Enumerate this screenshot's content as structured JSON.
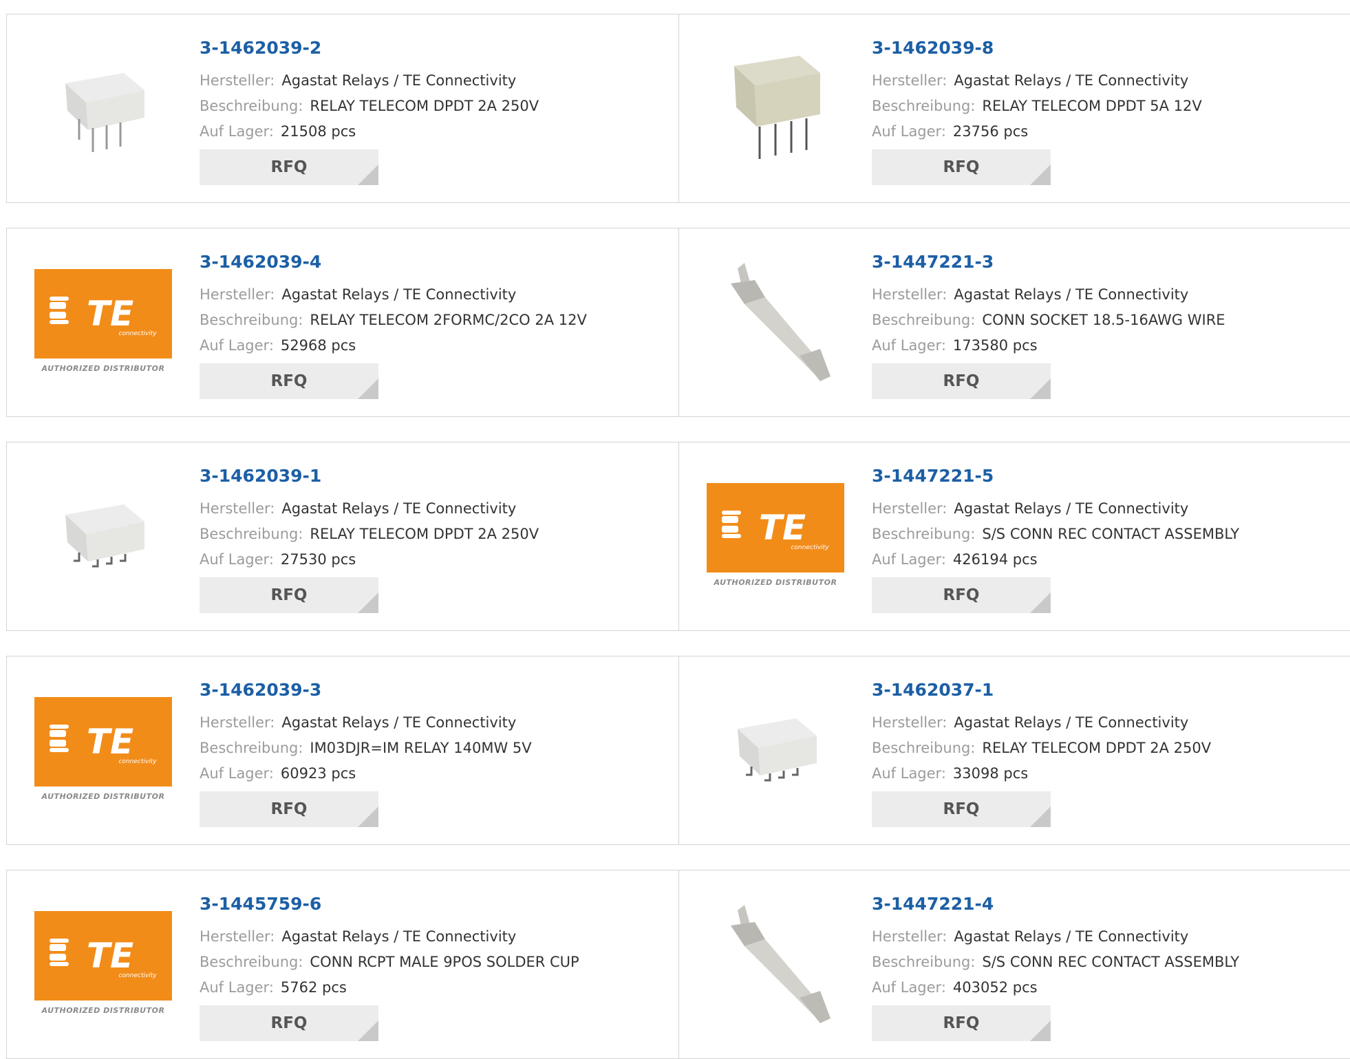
{
  "labels": {
    "manufacturer": "Hersteller:",
    "description": "Beschreibung:",
    "stock": "Auf Lager:",
    "rfq": "RFQ"
  },
  "te_logo": {
    "brand": "TE",
    "tagline": "connectivity",
    "badge": "AUTHORIZED DISTRIBUTOR"
  },
  "products": [
    {
      "pn": "3-1462039-2",
      "manufacturer": "Agastat Relays / TE Connectivity",
      "description": "RELAY TELECOM DPDT 2A 250V",
      "stock": "21508 pcs",
      "image": "relay-thru-hole"
    },
    {
      "pn": "3-1462039-8",
      "manufacturer": "Agastat Relays / TE Connectivity",
      "description": "RELAY TELECOM DPDT 5A 12V",
      "stock": "23756 pcs",
      "image": "relay-tan"
    },
    {
      "pn": "3-1462039-4",
      "manufacturer": "Agastat Relays / TE Connectivity",
      "description": "RELAY TELECOM 2FORMC/2CO 2A 12V",
      "stock": "52968 pcs",
      "image": "te-logo"
    },
    {
      "pn": "3-1447221-3",
      "manufacturer": "Agastat Relays / TE Connectivity",
      "description": "CONN SOCKET 18.5-16AWG WIRE",
      "stock": "173580 pcs",
      "image": "crimp-contact"
    },
    {
      "pn": "3-1462039-1",
      "manufacturer": "Agastat Relays / TE Connectivity",
      "description": "RELAY TELECOM DPDT 2A 250V",
      "stock": "27530 pcs",
      "image": "relay-smd"
    },
    {
      "pn": "3-1447221-5",
      "manufacturer": "Agastat Relays / TE Connectivity",
      "description": "S/S CONN REC CONTACT ASSEMBLY",
      "stock": "426194 pcs",
      "image": "te-logo"
    },
    {
      "pn": "3-1462039-3",
      "manufacturer": "Agastat Relays / TE Connectivity",
      "description": "IM03DJR=IM RELAY 140MW 5V",
      "stock": "60923 pcs",
      "image": "te-logo"
    },
    {
      "pn": "3-1462037-1",
      "manufacturer": "Agastat Relays / TE Connectivity",
      "description": "RELAY TELECOM DPDT 2A 250V",
      "stock": "33098 pcs",
      "image": "relay-smd"
    },
    {
      "pn": "3-1445759-6",
      "manufacturer": "Agastat Relays / TE Connectivity",
      "description": "CONN RCPT MALE 9POS SOLDER CUP",
      "stock": "5762 pcs",
      "image": "te-logo"
    },
    {
      "pn": "3-1447221-4",
      "manufacturer": "Agastat Relays / TE Connectivity",
      "description": "S/S CONN REC CONTACT ASSEMBLY",
      "stock": "403052 pcs",
      "image": "crimp-contact"
    }
  ]
}
